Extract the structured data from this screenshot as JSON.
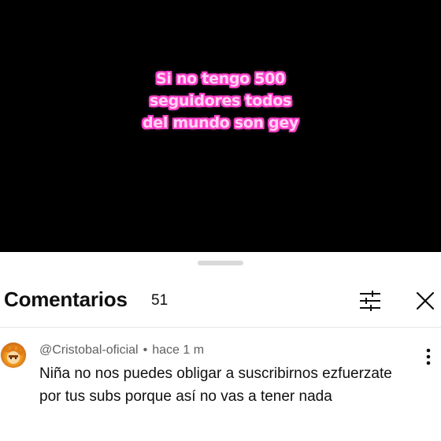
{
  "video": {
    "overlay_lines": [
      "Si no tengo 500",
      "seguidores todos",
      "del mundo son gey"
    ]
  },
  "comments_panel": {
    "title": "Comentarios",
    "count": "51",
    "filter_icon": "sliders-icon",
    "close_icon": "close-icon"
  },
  "comment": {
    "author": "@Cristobal-oficial",
    "separator": "•",
    "time": "hace 1 m",
    "text": "Niña no nos puedes obligar a suscribirnos ezfuerzate por tus subs porque así no vas a tener nada",
    "more_icon": "more-vertical-icon"
  },
  "colors": {
    "overlay_fill": "#ffd4f3",
    "overlay_outline": "#ff3ec8",
    "video_bg": "#000000",
    "text_primary": "#0f0f0f",
    "text_secondary": "#606060"
  }
}
